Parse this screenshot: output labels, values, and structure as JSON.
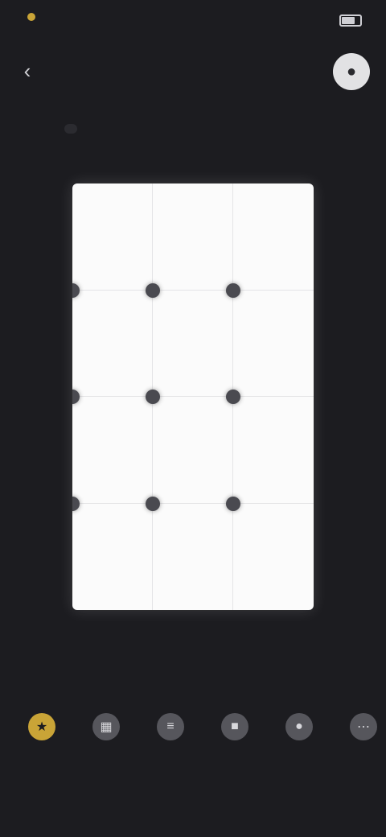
{
  "status": {
    "time": "",
    "right_text": ""
  },
  "header": {
    "back_icon": "chevron-left-icon",
    "title": "",
    "profile_icon": "avatar-icon"
  },
  "tabs": [
    {
      "label": "",
      "active": true
    },
    {
      "label": "",
      "active": false
    },
    {
      "label": "",
      "active": false
    }
  ],
  "grid": {
    "columns": 3,
    "rows": 4
  },
  "bottom_bar": [
    {
      "label": "",
      "icon": "star-icon",
      "active": true
    },
    {
      "label": "",
      "icon": "grid-icon",
      "active": false
    },
    {
      "label": "",
      "icon": "layers-icon",
      "active": false
    },
    {
      "label": "",
      "icon": "square-icon",
      "active": false
    },
    {
      "label": "",
      "icon": "circle-icon",
      "active": false
    },
    {
      "label": "",
      "icon": "more-icon",
      "active": false
    }
  ],
  "colors": {
    "background": "#1c1c20",
    "accent": "#c9a437",
    "canvas": "#fbfbfb"
  }
}
